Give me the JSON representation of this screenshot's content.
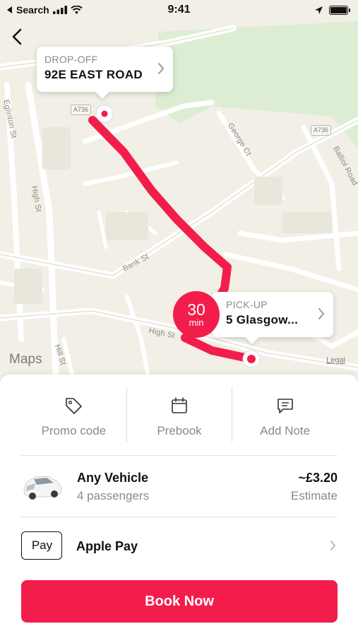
{
  "status_bar": {
    "back_app": "Search",
    "time": "9:41"
  },
  "map": {
    "brand": "Maps",
    "legal": "Legal",
    "streets": [
      "Eglinton St",
      "High St",
      "Bank St",
      "High St",
      "Hill St",
      "George Ct",
      "Balliol Road"
    ],
    "road_shields": [
      "A736",
      "A736"
    ],
    "route_color": "#f31d4b"
  },
  "dropoff": {
    "kicker": "DROP-OFF",
    "title": "92E EAST ROAD"
  },
  "pickup": {
    "kicker": "PICK-UP",
    "title": "5 Glasgow..."
  },
  "eta": {
    "value": "30",
    "unit": "min"
  },
  "actions": [
    {
      "label": "Promo code",
      "icon": "tag-icon"
    },
    {
      "label": "Prebook",
      "icon": "calendar-icon"
    },
    {
      "label": "Add Note",
      "icon": "message-icon"
    }
  ],
  "vehicle": {
    "name": "Any Vehicle",
    "passengers": "4 passengers",
    "price": "~£3.20",
    "price_note": "Estimate"
  },
  "payment": {
    "logo_text": "Pay",
    "method": "Apple Pay"
  },
  "book_button": "Book Now",
  "colors": {
    "accent": "#f31d4b",
    "map_bg": "#f1efe6",
    "park": "#dfeed6"
  }
}
